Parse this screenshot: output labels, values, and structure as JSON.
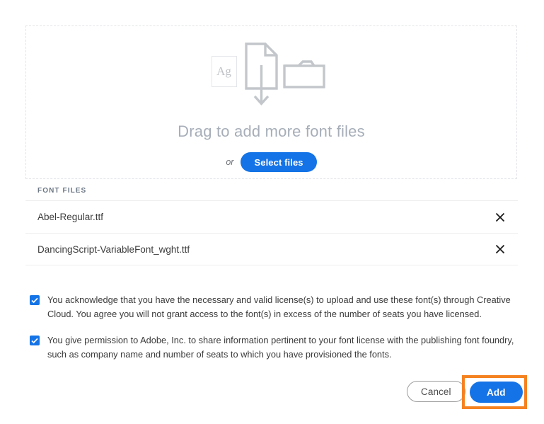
{
  "dropzone": {
    "title": "Drag to add more font files",
    "or_label": "or",
    "select_files_label": "Select files",
    "sample_glyph": "Ag",
    "icons": [
      "font-sample-icon",
      "document-download-icon",
      "folder-icon"
    ]
  },
  "file_list": {
    "section_label": "FONT FILES",
    "remove_icon": "close-icon",
    "files": [
      {
        "name": "Abel-Regular.ttf"
      },
      {
        "name": "DancingScript-VariableFont_wght.ttf"
      }
    ]
  },
  "consents": [
    {
      "checked": true,
      "text": "You acknowledge that you have the necessary and valid license(s) to upload and use these font(s) through Creative Cloud. You agree you will not grant access to the font(s) in excess of the number of seats you have licensed."
    },
    {
      "checked": true,
      "text": "You give permission to Adobe, Inc. to share information pertinent to your font license with the publishing font foundry, such as company name and number of seats to which you have provisioned the fonts."
    }
  ],
  "footer": {
    "cancel_label": "Cancel",
    "add_label": "Add"
  },
  "colors": {
    "accent_blue": "#1473e6",
    "highlight_orange": "#f58220",
    "title_gray": "#a7aeb8",
    "icon_gray": "#c3c7cb",
    "section_label_gray": "#6b7684"
  }
}
